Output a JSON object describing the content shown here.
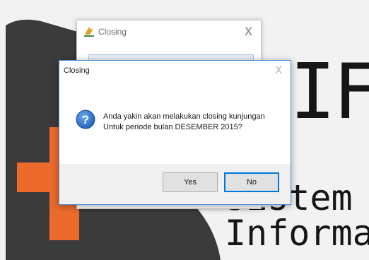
{
  "colors": {
    "accent_orange": "#ec6a2c",
    "logo_dark": "#3b3b3b",
    "dialog_border": "#4a90d6",
    "question_icon": "#1c5fb5"
  },
  "background": {
    "logo_text": "IF",
    "subtitle_line1": "Sistem",
    "subtitle_line2": "Informa"
  },
  "back_window": {
    "title": "Closing",
    "close_glyph": "X",
    "icon": "app-logo-icon"
  },
  "dialog": {
    "title": "Closing",
    "close_glyph": "X",
    "icon": "question-icon",
    "message_line1": "Anda yakin akan melakukan closing kunjungan",
    "message_line2": "Untuk periode bulan DESEMBER 2015?",
    "buttons": {
      "yes": "Yes",
      "no": "No"
    }
  }
}
